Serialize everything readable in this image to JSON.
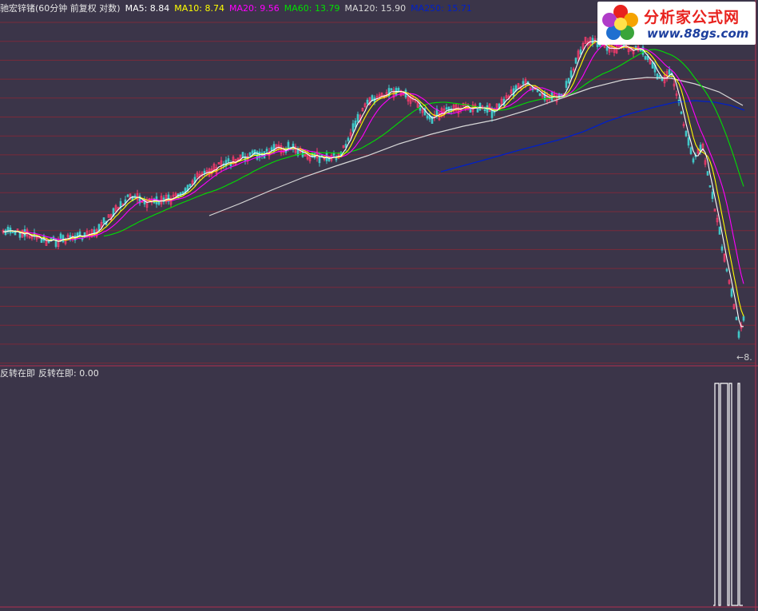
{
  "header": {
    "title": "驰宏锌锗(60分钟 前复权 对数)",
    "indicators": [
      {
        "label": "MA5: 8.84",
        "color": "#ffffff"
      },
      {
        "label": "MA10: 8.74",
        "color": "#ffff00"
      },
      {
        "label": "MA20: 9.56",
        "color": "#ff00ff"
      },
      {
        "label": "MA60: 13.79",
        "color": "#00e000"
      },
      {
        "label": "MA120: 15.90",
        "color": "#d8d8d8"
      },
      {
        "label": "MA250: 15.71",
        "color": "#0020c8"
      }
    ]
  },
  "sub_header": {
    "title": "反转在即",
    "value_label": "反转在即: 0.00"
  },
  "price_tag": "←8.",
  "logo": {
    "line1": "分析家公式网",
    "line2": "www.88gs.com"
  },
  "colors": {
    "background": "#3b3549",
    "grid_line": "#7a2a3a",
    "candle_up": "#ff3c6e",
    "candle_down": "#40c8c8",
    "signal_line": "#ffffff"
  },
  "chart_data": {
    "type": "line",
    "title": "驰宏锌锗(60分钟 前复权 对数)",
    "series": [
      {
        "name": "MA5",
        "last": 8.84,
        "color": "#ffffff"
      },
      {
        "name": "MA10",
        "last": 8.74,
        "color": "#ffff00"
      },
      {
        "name": "MA20",
        "last": 9.56,
        "color": "#ff00ff"
      },
      {
        "name": "MA60",
        "last": 13.79,
        "color": "#00e000"
      },
      {
        "name": "MA120",
        "last": 15.9,
        "color": "#d8d8d8"
      },
      {
        "name": "MA250",
        "last": 15.71,
        "color": "#0020c8"
      }
    ],
    "sub_chart": {
      "name": "反转在即",
      "last": 0.0
    }
  }
}
